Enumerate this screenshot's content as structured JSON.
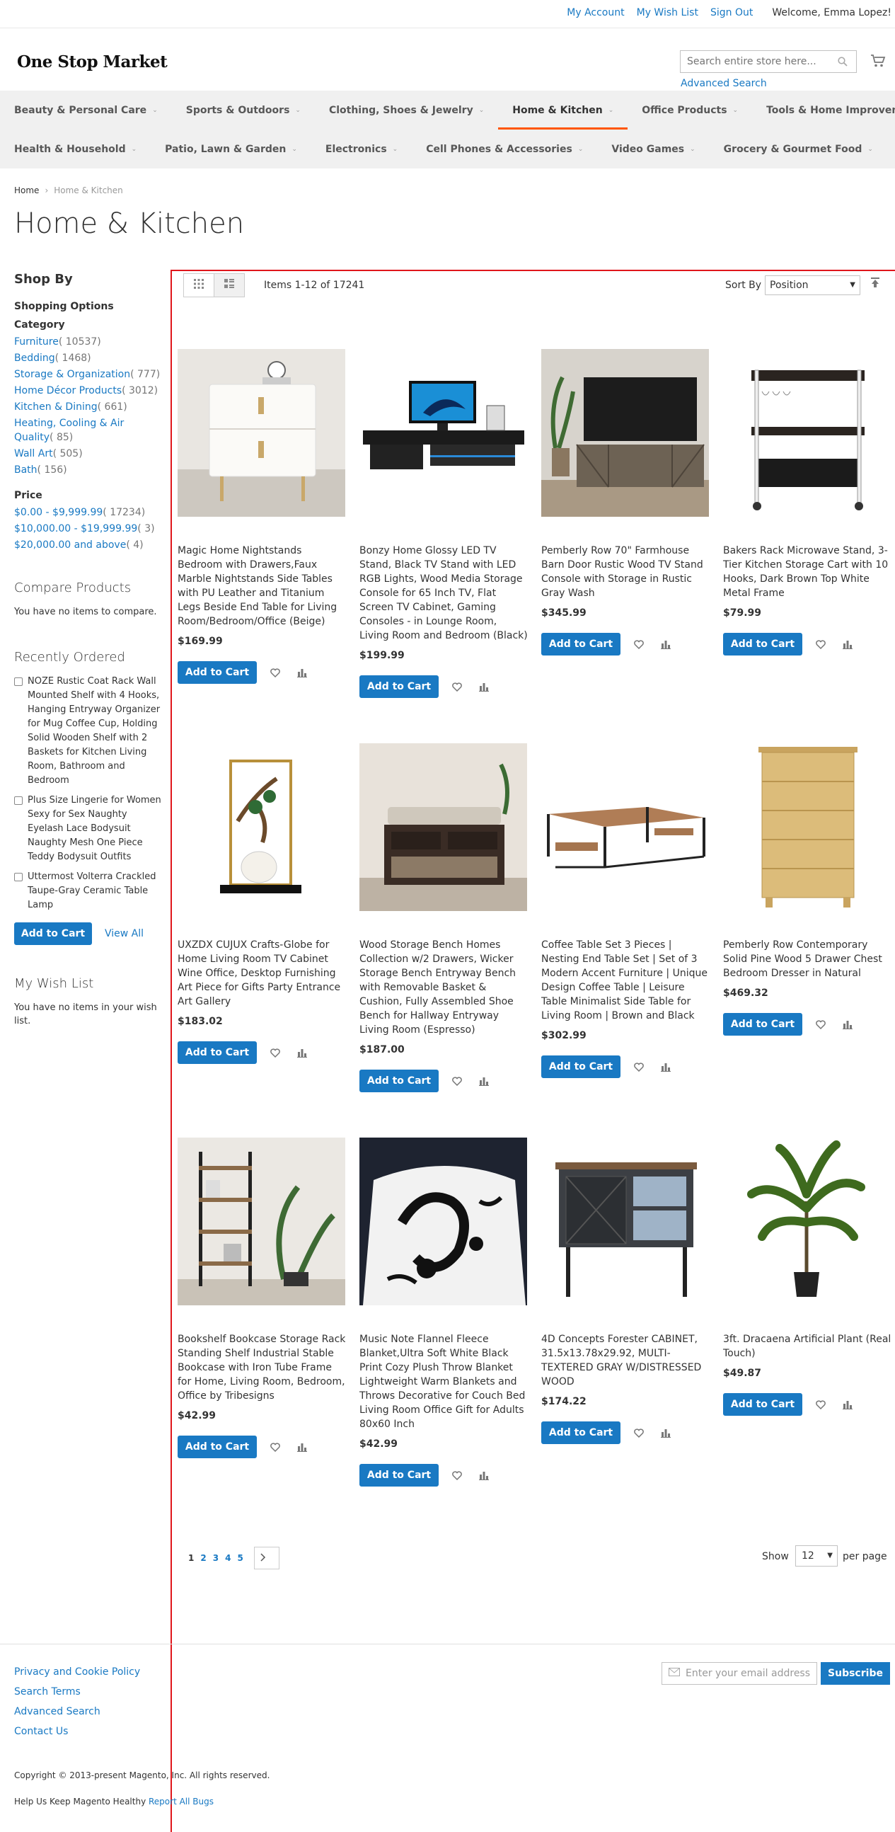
{
  "header": {
    "links": [
      "My Account",
      "My Wish List",
      "Sign Out"
    ],
    "welcome": "Welcome, Emma Lopez!",
    "logo": "One Stop Market",
    "search_placeholder": "Search entire store here...",
    "advanced_search": "Advanced Search"
  },
  "nav": {
    "row1": [
      "Beauty & Personal Care",
      "Sports & Outdoors",
      "Clothing, Shoes & Jewelry",
      "Home & Kitchen",
      "Office Products",
      "Tools & Home Improvement"
    ],
    "row2": [
      "Health & Household",
      "Patio, Lawn & Garden",
      "Electronics",
      "Cell Phones & Accessories",
      "Video Games",
      "Grocery & Gourmet Food"
    ],
    "active": "Home & Kitchen"
  },
  "breadcrumb": {
    "home": "Home",
    "current": "Home & Kitchen"
  },
  "page_title": "Home & Kitchen",
  "sidebar": {
    "shop_by": "Shop By",
    "shopping_options": "Shopping Options",
    "category_label": "Category",
    "categories": [
      {
        "name": "Furniture",
        "count": "( 10537)"
      },
      {
        "name": "Bedding",
        "count": "( 1468)"
      },
      {
        "name": "Storage & Organization",
        "count": "( 777)"
      },
      {
        "name": "Home Décor Products",
        "count": "( 3012)"
      },
      {
        "name": "Kitchen & Dining",
        "count": "( 661)"
      },
      {
        "name": "Heating, Cooling & Air Quality",
        "count": "( 85)"
      },
      {
        "name": "Wall Art",
        "count": "( 505)"
      },
      {
        "name": "Bath",
        "count": "( 156)"
      }
    ],
    "price_label": "Price",
    "prices": [
      {
        "name": "$0.00 - $9,999.99",
        "count": "( 17234)"
      },
      {
        "name": "$10,000.00 - $19,999.99",
        "count": "( 3)"
      },
      {
        "name": "$20,000.00 and above",
        "count": "( 4)"
      }
    ],
    "compare_title": "Compare Products",
    "compare_text": "You have no items to compare.",
    "recent_title": "Recently Ordered",
    "recent_items": [
      "NOZE Rustic Coat Rack Wall Mounted Shelf with 4 Hooks, Hanging Entryway Organizer for Mug Coffee Cup, Holding Solid Wooden Shelf with 2 Baskets for Kitchen Living Room, Bathroom and Bedroom",
      "Plus Size Lingerie for Women Sexy for Sex Naughty Eyelash Lace Bodysuit Naughty Mesh One Piece Teddy Bodysuit Outfits",
      "Uttermost Volterra Crackled Taupe-Gray Ceramic Table Lamp"
    ],
    "add_to_cart": "Add to Cart",
    "view_all": "View All",
    "wishlist_title": "My Wish List",
    "wishlist_text": "You have no items in your wish list."
  },
  "toolbar": {
    "items_count": "Items 1-12 of 17241",
    "sort_label": "Sort By",
    "sort_value": "Position",
    "show_label": "Show",
    "limit_value": "12",
    "per_page": "per page",
    "pages": [
      "1",
      "2",
      "3",
      "4",
      "5"
    ]
  },
  "products": [
    {
      "name": "Magic Home Nightstands Bedroom with Drawers,Faux Marble Nightstands Side Tables with PU Leather and Titanium Legs Beside End Table for Living Room/Bedroom/Office (Beige)",
      "price": "$169.99",
      "image": "white-nightstand-image"
    },
    {
      "name": "Bonzy Home Glossy LED TV Stand, Black TV Stand with LED RGB Lights, Wood Media Storage Console for 65 Inch TV, Flat Screen TV Cabinet, Gaming Consoles - in Lounge Room, Living Room and Bedroom (Black)",
      "price": "$199.99",
      "image": "tv-stand-image"
    },
    {
      "name": "Pemberly Row 70\" Farmhouse Barn Door Rustic Wood TV Stand Console with Storage in Rustic Gray Wash",
      "price": "$345.99",
      "image": "barn-tv-console-image"
    },
    {
      "name": "Bakers Rack Microwave Stand, 3-Tier Kitchen Storage Cart with 10 Hooks, Dark Brown Top White Metal Frame",
      "price": "$79.99",
      "image": "bakers-rack-image"
    },
    {
      "name": "UXZDX CUJUX Crafts-Globe for Home Living Room TV Cabinet Wine Office, Desktop Furnishing Art Piece for Gifts Party Entrance Art Gallery",
      "price": "$183.02",
      "image": "bird-sculpture-image"
    },
    {
      "name": "Wood Storage Bench Homes Collection w/2 Drawers, Wicker Storage Bench Entryway Bench with Removable Basket & Cushion, Fully Assembled Shoe Bench for Hallway Entryway Living Room (Espresso)",
      "price": "$187.00",
      "image": "storage-bench-image"
    },
    {
      "name": "Coffee Table Set 3 Pieces | Nesting End Table Set | Set of 3 Modern Accent Furniture | Unique Design Coffee Table | Leisure Table Minimalist Side Table for Living Room | Brown and Black",
      "price": "$302.99",
      "image": "coffee-table-set-image"
    },
    {
      "name": "Pemberly Row Contemporary Solid Pine Wood 5 Drawer Chest Bedroom Dresser in Natural",
      "price": "$469.32",
      "image": "pine-dresser-image"
    },
    {
      "name": "Bookshelf Bookcase Storage Rack Standing Shelf Industrial Stable Bookcase with Iron Tube Frame for Home, Living Room, Bedroom, Office by Tribesigns",
      "price": "$42.99",
      "image": "bookshelf-image"
    },
    {
      "name": "Music Note Flannel Fleece Blanket,Ultra Soft White Black Print Cozy Plush Throw Blanket Lightweight Warm Blankets and Throws Decorative for Couch Bed Living Room Office Gift for Adults 80x60 Inch",
      "price": "$42.99",
      "image": "music-blanket-image"
    },
    {
      "name": "4D Concepts Forester CABINET, 31.5x13.78x29.92, MULTI-TEXTERED GRAY W/DISTRESSED WOOD",
      "price": "$174.22",
      "image": "forester-cabinet-image"
    },
    {
      "name": "3ft. Dracaena Artificial Plant (Real Touch)",
      "price": "$49.87",
      "image": "dracaena-plant-image"
    }
  ],
  "product_cta": "Add to Cart",
  "footer": {
    "links": [
      "Privacy and Cookie Policy",
      "Search Terms",
      "Advanced Search",
      "Contact Us"
    ],
    "newsletter_placeholder": "Enter your email address",
    "subscribe": "Subscribe",
    "copyright": "Copyright © 2013-present Magento, Inc. All rights reserved.",
    "help_text": "Help Us Keep Magento Healthy",
    "report_bugs": "Report All Bugs"
  },
  "colors": {
    "link": "#1979c3",
    "button": "#1979c3",
    "nav_active": "#ff5501",
    "frame": "#e0161b"
  }
}
